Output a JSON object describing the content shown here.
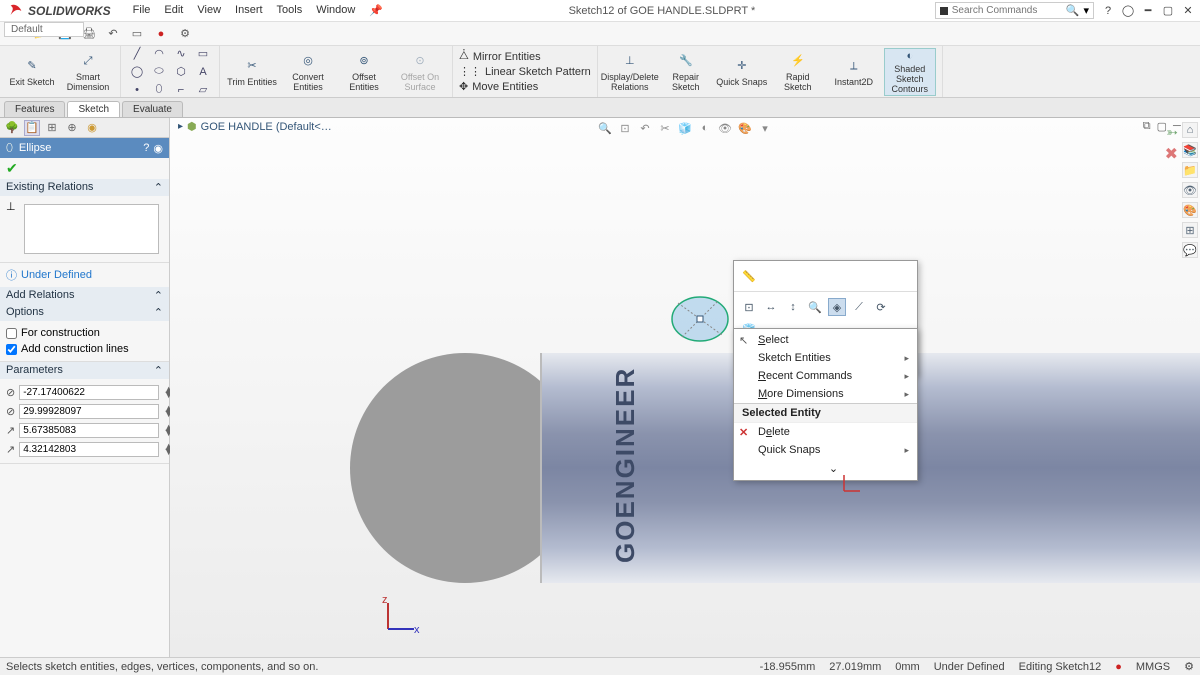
{
  "brand": "SOLIDWORKS",
  "menubar": [
    "File",
    "Edit",
    "View",
    "Insert",
    "Tools",
    "Window"
  ],
  "title": "Sketch12 of GOE HANDLE.SLDPRT *",
  "search_placeholder": "Search Commands",
  "config_default": "Default",
  "ribbon": {
    "exit_sketch": "Exit\nSketch",
    "smart_dim": "Smart\nDimension",
    "trim": "Trim\nEntities",
    "convert": "Convert\nEntities",
    "offset": "Offset\nEntities",
    "offset_surf": "Offset\nOn\nSurface",
    "mirror": "Mirror Entities",
    "linear": "Linear Sketch Pattern",
    "move": "Move Entities",
    "display_rel": "Display/Delete\nRelations",
    "repair": "Repair\nSketch",
    "quick_snaps": "Quick\nSnaps",
    "rapid": "Rapid\nSketch",
    "instant2d": "Instant2D",
    "shaded": "Shaded\nSketch\nContours"
  },
  "tabs": [
    "Features",
    "Sketch",
    "Evaluate"
  ],
  "active_tab": "Sketch",
  "breadcrumb": "GOE HANDLE (Default<…",
  "pm": {
    "title": "Ellipse",
    "existing": "Existing Relations",
    "under_defined": "Under Defined",
    "add_relations": "Add Relations",
    "options": "Options",
    "for_construction": "For construction",
    "add_construction_lines": "Add construction lines",
    "parameters": "Parameters",
    "params": [
      "-27.17400622",
      "29.99928097",
      "5.67385083",
      "4.32142803"
    ]
  },
  "context": {
    "select": "Select",
    "sketch_entities": "Sketch Entities",
    "recent": "Recent Commands",
    "more_dim": "More Dimensions",
    "selected_entity": "Selected Entity",
    "delete": "Delete",
    "quick_snaps": "Quick Snaps"
  },
  "model_text": "GOENGINEER",
  "statusbar": {
    "hint": "Selects sketch entities, edges, vertices, components, and so on.",
    "coord_x": "-18.955mm",
    "coord_y": "27.019mm",
    "coord_z": "0mm",
    "state": "Under Defined",
    "editing": "Editing Sketch12",
    "units": "MMGS"
  }
}
